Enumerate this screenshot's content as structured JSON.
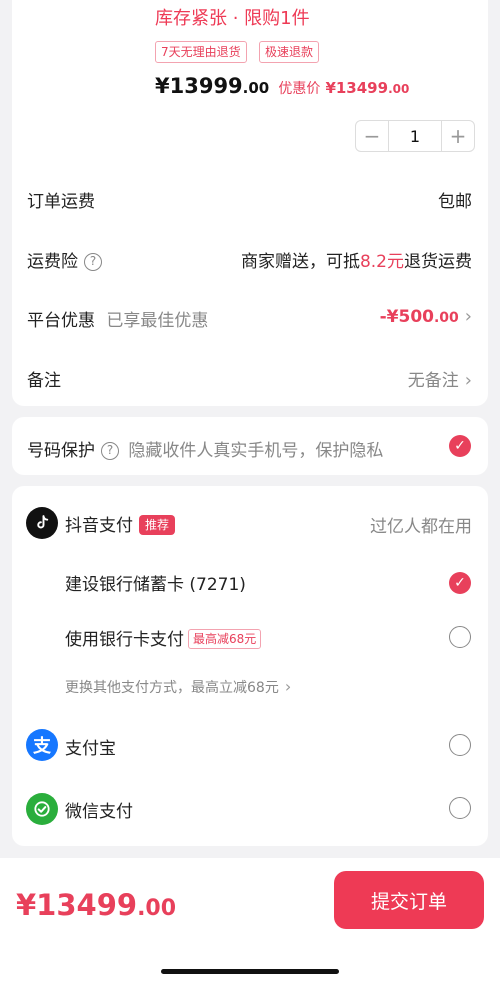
{
  "product": {
    "stock_notice": "库存紧张 · 限购1件",
    "tags": [
      "7天无理由退货",
      "极速退款"
    ],
    "price_int": "¥13999",
    "price_dec": ".00",
    "discount_label": "优惠价",
    "discount_int": "¥13499",
    "discount_dec": ".00",
    "quantity": "1",
    "minus": "−",
    "plus": "+"
  },
  "order": {
    "shipping_label": "订单运费",
    "shipping_value": "包邮",
    "insurance_label": "运费险",
    "insurance_prefix": "商家赠送，可抵",
    "insurance_amount": "8.2元",
    "insurance_suffix": "退货运费",
    "platform_label": "平台优惠",
    "platform_note": "已享最佳优惠",
    "platform_value_int": "-¥500",
    "platform_value_dec": ".00",
    "remark_label": "备注",
    "remark_value": "无备注"
  },
  "privacy": {
    "label": "号码保护",
    "desc": "隐藏收件人真实手机号，保护隐私"
  },
  "payment": {
    "douyin_label": "抖音支付",
    "douyin_badge": "推荐",
    "douyin_right": "过亿人都在用",
    "bank_card": "建设银行储蓄卡 (7271)",
    "use_bank_card": "使用银行卡支付",
    "use_bank_badge": "最高减68元",
    "other_methods": "更换其他支付方式，最高立减68元",
    "alipay": "支付宝",
    "wechat": "微信支付"
  },
  "footer": {
    "total_int": "¥13499",
    "total_dec": ".00",
    "submit": "提交订单"
  },
  "icons": {
    "help": "?",
    "chevron": "›",
    "check": "✓",
    "alipay_glyph": "支"
  },
  "colors": {
    "accent": "#e8405b",
    "alipay": "#1677ff",
    "wechat": "#2aae3c"
  }
}
